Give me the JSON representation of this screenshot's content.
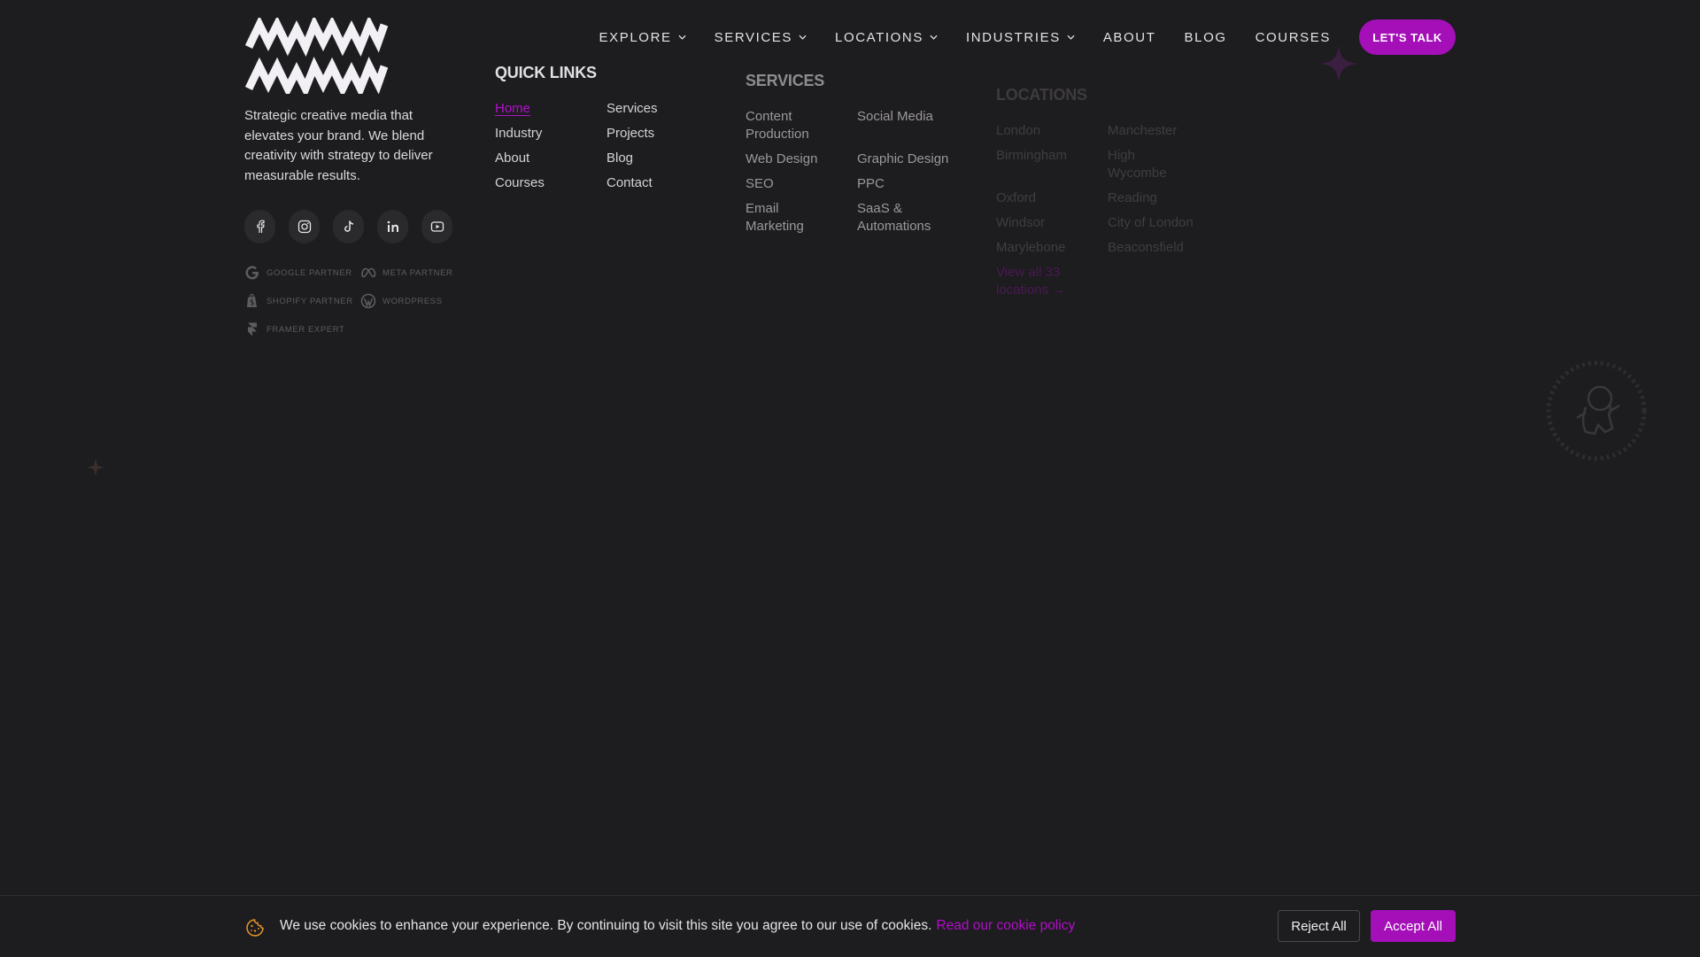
{
  "header": {
    "logo_icon": "zigzag-logo-icon",
    "nav": [
      {
        "label": "EXPLORE",
        "has_dropdown": true
      },
      {
        "label": "SERVICES",
        "has_dropdown": true
      },
      {
        "label": "LOCATIONS",
        "has_dropdown": true
      },
      {
        "label": "INDUSTRIES",
        "has_dropdown": true
      },
      {
        "label": "ABOUT",
        "has_dropdown": false
      },
      {
        "label": "BLOG",
        "has_dropdown": false
      },
      {
        "label": "COURSES",
        "has_dropdown": false
      }
    ],
    "cta_label": "LET'S TALK"
  },
  "brand": {
    "tagline": "Strategic creative media that elevates your brand. We blend creativity with strategy to deliver measurable results.",
    "socials": [
      "facebook-icon",
      "instagram-icon",
      "tiktok-icon",
      "linkedin-icon",
      "youtube-icon"
    ],
    "badges": [
      {
        "label": "GOOGLE PARTNER",
        "icon": "google-icon"
      },
      {
        "label": "META PARTNER",
        "icon": "meta-icon"
      },
      {
        "label": "SHOPIFY PARTNER",
        "icon": "shopify-icon"
      },
      {
        "label": "WORDPRESS",
        "icon": "wordpress-icon"
      },
      {
        "label": "FRAMER EXPERT",
        "icon": "framer-icon"
      }
    ]
  },
  "quick_links": {
    "heading": "QUICK LINKS",
    "links": [
      "Home",
      "Industry",
      "About",
      "Courses",
      "Services",
      "Projects",
      "Blog",
      "Contact"
    ],
    "active": "Home"
  },
  "services": {
    "heading": "SERVICES",
    "links": [
      "Content Production",
      "Web Design",
      "SEO",
      "Email Marketing",
      "Social Media",
      "Graphic Design",
      "PPC",
      "SaaS & Automations"
    ]
  },
  "locations": {
    "heading": "LOCATIONS",
    "links": [
      "London",
      "Birmingham",
      "Oxford",
      "Windsor",
      "Marylebone",
      "Manchester",
      "High Wycombe",
      "Reading",
      "City of London",
      "Beaconsfield"
    ],
    "view_all": "View all 33 locations →"
  },
  "cookie": {
    "icon": "cookie-icon",
    "text": "We use cookies to enhance your experience. By continuing to visit this site you agree to our use of cookies.",
    "link": "Read our cookie policy",
    "reject": "Reject All",
    "accept": "Accept All"
  },
  "colors": {
    "background": "#1d1c1e",
    "accent": "#a40fb8",
    "text": "#d6d4d8"
  }
}
